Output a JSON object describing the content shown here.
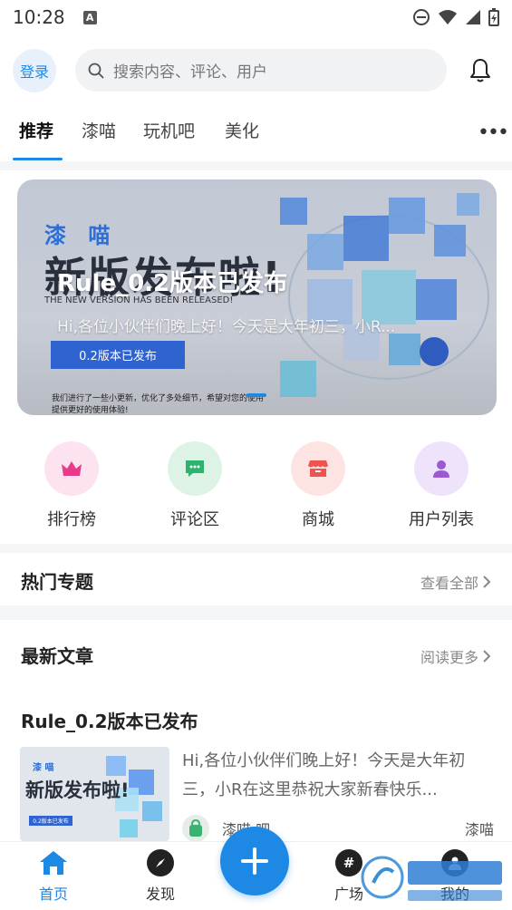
{
  "status": {
    "time": "10:28",
    "notif_letter": "A"
  },
  "header": {
    "login_label": "登录",
    "search_placeholder": "搜索内容、评论、用户"
  },
  "tabs": [
    {
      "label": "推荐",
      "active": true
    },
    {
      "label": "漆喵",
      "active": false
    },
    {
      "label": "玩机吧",
      "active": false
    },
    {
      "label": "美化",
      "active": false
    }
  ],
  "banner": {
    "brand": "漆 喵",
    "headline": "新版发布啦!",
    "english": "THE NEW VERSION HAS BEEN RELEASED!",
    "title": "Rule_0.2版本已发布",
    "description": "Hi,各位小伙伴们晚上好！今天是大年初三，小R...",
    "tag": "0.2版本已发布",
    "small_text": "我们进行了一些小更新，优化了多处细节，希望对您的使用提供更好的使用体验!"
  },
  "quick_links": [
    {
      "label": "排行榜",
      "icon": "crown-icon",
      "bg": "#fde3ef",
      "color": "#ea3a8a"
    },
    {
      "label": "评论区",
      "icon": "chat-icon",
      "bg": "#ddf3e6",
      "color": "#2db36b"
    },
    {
      "label": "商城",
      "icon": "store-icon",
      "bg": "#fde4e2",
      "color": "#ef5350"
    },
    {
      "label": "用户列表",
      "icon": "user-icon",
      "bg": "#efe3fb",
      "color": "#9b59d6"
    }
  ],
  "hot_topics": {
    "title": "热门专题",
    "more": "查看全部"
  },
  "latest": {
    "title": "最新文章",
    "more": "阅读更多"
  },
  "article": {
    "title": "Rule_0.2版本已发布",
    "description": "Hi,各位小伙伴们晚上好！今天是大年初三，小R在这里恭祝大家新春快乐...",
    "thumb_brand": "漆 喵",
    "thumb_headline": "新版发布啦!",
    "thumb_tag": "0.2版本已发布",
    "category": "漆喵·吧",
    "author": "漆喵"
  },
  "bottom_nav": [
    {
      "label": "首页",
      "icon": "home-icon",
      "active": true
    },
    {
      "label": "发现",
      "icon": "compass-icon",
      "active": false
    },
    {
      "label": "广场",
      "icon": "hashtag-icon",
      "active": false
    },
    {
      "label": "我的",
      "icon": "profile-icon",
      "active": false
    }
  ],
  "colors": {
    "accent": "#1e88e5",
    "band": "#f4f5f7"
  }
}
